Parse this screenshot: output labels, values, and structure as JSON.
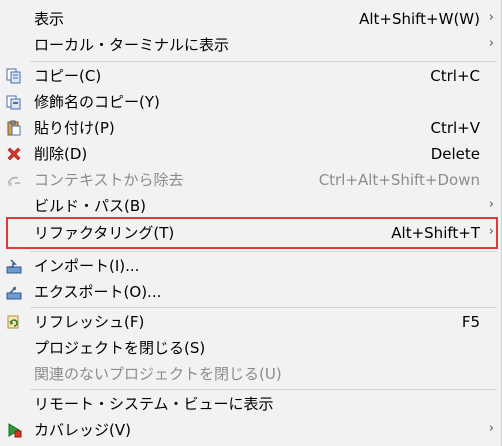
{
  "menu": {
    "items": [
      {
        "label": "表示",
        "shortcut": "Alt+Shift+W(W)",
        "submenu": true,
        "icon": null,
        "disabled": false
      },
      {
        "label": "ローカル・ターミナルに表示",
        "shortcut": "",
        "submenu": true,
        "icon": null,
        "disabled": false
      },
      {
        "label": "コピー(C)",
        "shortcut": "Ctrl+C",
        "submenu": false,
        "icon": "copy-icon",
        "disabled": false
      },
      {
        "label": "修飾名のコピー(Y)",
        "shortcut": "",
        "submenu": false,
        "icon": "copy-qualified-name-icon",
        "disabled": false
      },
      {
        "label": "貼り付け(P)",
        "shortcut": "Ctrl+V",
        "submenu": false,
        "icon": "paste-icon",
        "disabled": false
      },
      {
        "label": "削除(D)",
        "shortcut": "Delete",
        "submenu": false,
        "icon": "delete-icon",
        "disabled": false
      },
      {
        "label": "コンテキストから除去",
        "shortcut": "Ctrl+Alt+Shift+Down",
        "submenu": false,
        "icon": "remove-context-icon",
        "disabled": true
      },
      {
        "label": "ビルド・パス(B)",
        "shortcut": "",
        "submenu": true,
        "icon": null,
        "disabled": false
      },
      {
        "label": "リファクタリング(T)",
        "shortcut": "Alt+Shift+T",
        "submenu": true,
        "icon": null,
        "disabled": false
      },
      {
        "label": "インポート(I)...",
        "shortcut": "",
        "submenu": false,
        "icon": "import-icon",
        "disabled": false
      },
      {
        "label": "エクスポート(O)...",
        "shortcut": "",
        "submenu": false,
        "icon": "export-icon",
        "disabled": false
      },
      {
        "label": "リフレッシュ(F)",
        "shortcut": "F5",
        "submenu": false,
        "icon": "refresh-icon",
        "disabled": false
      },
      {
        "label": "プロジェクトを閉じる(S)",
        "shortcut": "",
        "submenu": false,
        "icon": null,
        "disabled": false
      },
      {
        "label": "関連のないプロジェクトを閉じる(U)",
        "shortcut": "",
        "submenu": false,
        "icon": null,
        "disabled": true
      },
      {
        "label": "リモート・システム・ビューに表示",
        "shortcut": "",
        "submenu": false,
        "icon": null,
        "disabled": false
      },
      {
        "label": "カバレッジ(V)",
        "shortcut": "",
        "submenu": true,
        "icon": "coverage-icon",
        "disabled": false
      }
    ],
    "arrow_glyph": "›",
    "highlight_color": "#e03a3a"
  }
}
